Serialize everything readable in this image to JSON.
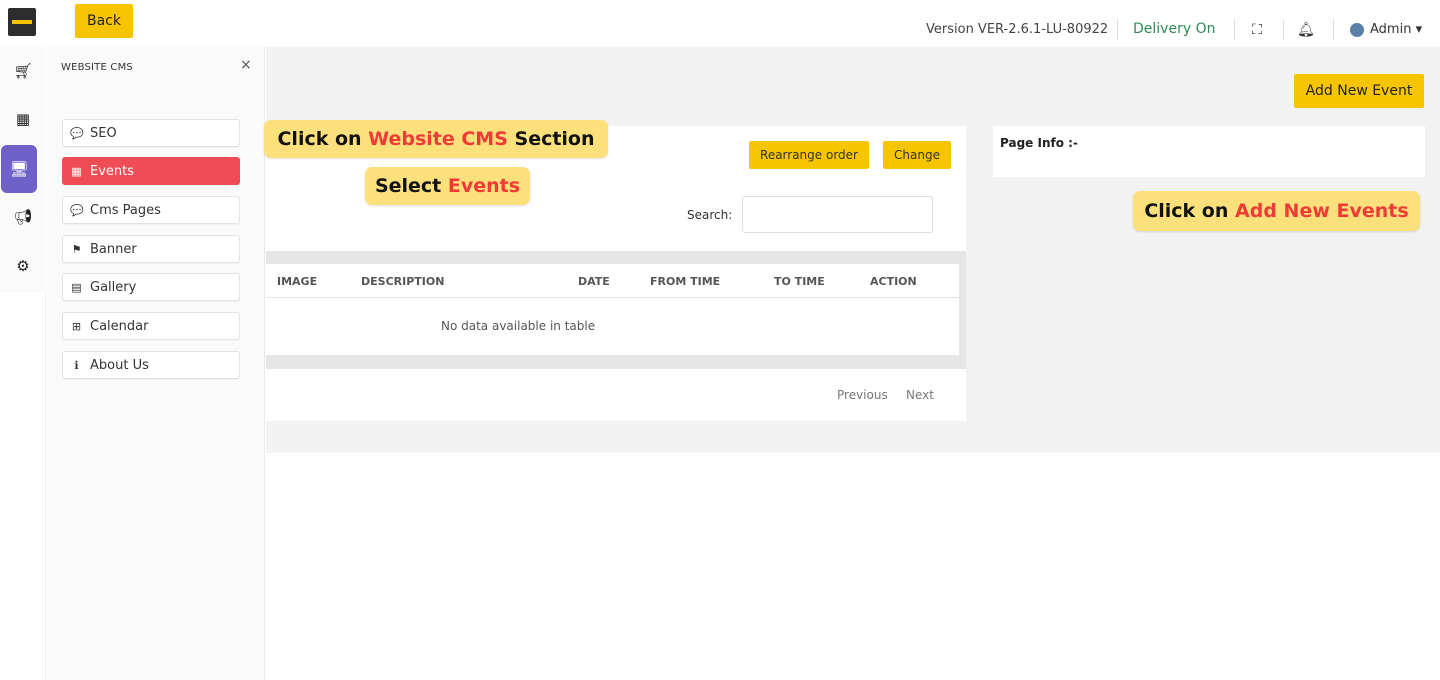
{
  "header": {
    "back_label": "Back",
    "version_text": "Version VER-2.6.1-LU-80922",
    "delivery_status": "Delivery On",
    "user_label": "Admin ▾"
  },
  "icons": {
    "logo": "logo-icon",
    "fullscreen": "fullscreen-icon",
    "notifications": "bell-icon",
    "avatar": "avatar-icon",
    "rail": [
      "cart-icon",
      "calculator-icon",
      "monitor-icon",
      "megaphone-icon",
      "gear-icon"
    ]
  },
  "panel": {
    "title": "WEBSITE CMS",
    "close": "×",
    "items": [
      {
        "label": "SEO",
        "icon": "comments-icon",
        "glyph": "💬"
      },
      {
        "label": "Events",
        "icon": "calendar-icon",
        "glyph": "▦"
      },
      {
        "label": "Cms Pages",
        "icon": "comments-icon",
        "glyph": "💬"
      },
      {
        "label": "Banner",
        "icon": "flag-icon",
        "glyph": "⚑"
      },
      {
        "label": "Gallery",
        "icon": "file-image-icon",
        "glyph": "▤"
      },
      {
        "label": "Calendar",
        "icon": "plus-square-icon",
        "glyph": "⊞"
      },
      {
        "label": "About Us",
        "icon": "info-circle-icon",
        "glyph": "ℹ"
      }
    ]
  },
  "main": {
    "add_event_label": "Add New Event",
    "rearrange_label": "Rearrange order",
    "change_label": "Change",
    "search_label": "Search:",
    "search_value": "",
    "table": {
      "columns": [
        "IMAGE",
        "DESCRIPTION",
        "DATE",
        "FROM TIME",
        "TO TIME",
        "ACTION"
      ],
      "empty_message": "No data available in table"
    },
    "pagination": {
      "previous": "Previous",
      "next": "Next"
    },
    "page_info_label": "Page Info :-"
  },
  "callouts": {
    "c1": {
      "pre": "Click on ",
      "hl": "Website CMS",
      "post": " Section"
    },
    "c2": {
      "pre": "Select ",
      "hl": "Events"
    },
    "c3": {
      "pre": "Click on ",
      "hl": "Add New Events"
    }
  },
  "colors": {
    "accent_yellow": "#f7c500",
    "active_red": "#ef4c56",
    "rail_active": "#6f61c7",
    "delivery_green": "#2e8b57",
    "callout_bg": "#fbe07c",
    "callout_highlight": "#ef3b36"
  }
}
